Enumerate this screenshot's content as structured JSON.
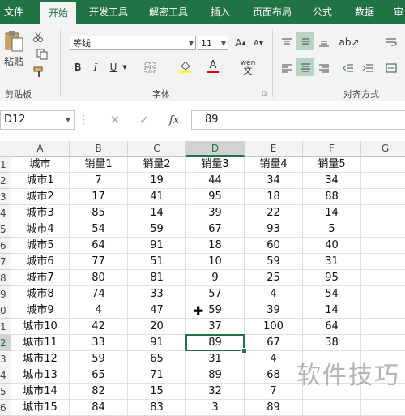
{
  "tabs": [
    "文件",
    "开始",
    "开发工具",
    "解密工具",
    "插入",
    "页面布局",
    "公式",
    "数据",
    "审"
  ],
  "active_tab": "开始",
  "ribbon": {
    "clipboard": {
      "paste_label": "粘贴",
      "group_label": "剪贴板"
    },
    "font": {
      "font_name": "等线",
      "font_size": "11",
      "bold": "B",
      "italic": "I",
      "underline": "U",
      "font_color_letter": "A",
      "phonetic_label": "wén",
      "group_label": "字体"
    },
    "alignment": {
      "group_label": "对齐方式"
    }
  },
  "formula_bar": {
    "name_box": "D12",
    "fx_symbol": "fx",
    "value": "89"
  },
  "columns": [
    "A",
    "B",
    "C",
    "D",
    "E",
    "F",
    "G"
  ],
  "selected_column": "D",
  "row_numbers": [
    "1",
    "2",
    "3",
    "4",
    "5",
    "6",
    "7",
    "8",
    "9",
    "10",
    "11",
    "12",
    "13",
    "14",
    "15",
    "16"
  ],
  "selected_row": "12",
  "table": {
    "headers": [
      "城市",
      "销量1",
      "销量2",
      "销量3",
      "销量4",
      "销量5"
    ],
    "rows": [
      [
        "城市1",
        "7",
        "19",
        "44",
        "34",
        "34"
      ],
      [
        "城市2",
        "17",
        "41",
        "95",
        "18",
        "88"
      ],
      [
        "城市3",
        "85",
        "14",
        "39",
        "22",
        "14"
      ],
      [
        "城市4",
        "54",
        "59",
        "67",
        "93",
        "5"
      ],
      [
        "城市5",
        "64",
        "91",
        "18",
        "60",
        "40"
      ],
      [
        "城市6",
        "77",
        "51",
        "10",
        "59",
        "31"
      ],
      [
        "城市7",
        "80",
        "81",
        "9",
        "25",
        "95"
      ],
      [
        "城市8",
        "74",
        "33",
        "57",
        "4",
        "54"
      ],
      [
        "城市9",
        "4",
        "47",
        "59",
        "39",
        "14"
      ],
      [
        "城市10",
        "42",
        "20",
        "37",
        "100",
        "64"
      ],
      [
        "城市11",
        "33",
        "91",
        "89",
        "67",
        "38"
      ],
      [
        "城市12",
        "59",
        "65",
        "31",
        "4",
        ""
      ],
      [
        "城市13",
        "65",
        "71",
        "89",
        "68",
        ""
      ],
      [
        "城市14",
        "82",
        "15",
        "32",
        "7",
        ""
      ],
      [
        "城市15",
        "84",
        "83",
        "3",
        "89",
        ""
      ]
    ]
  },
  "watermark": "软件技巧",
  "colors": {
    "excel_green": "#217346",
    "ribbon_bg": "#f3f3f3",
    "highlight": "#b9d3c4"
  }
}
